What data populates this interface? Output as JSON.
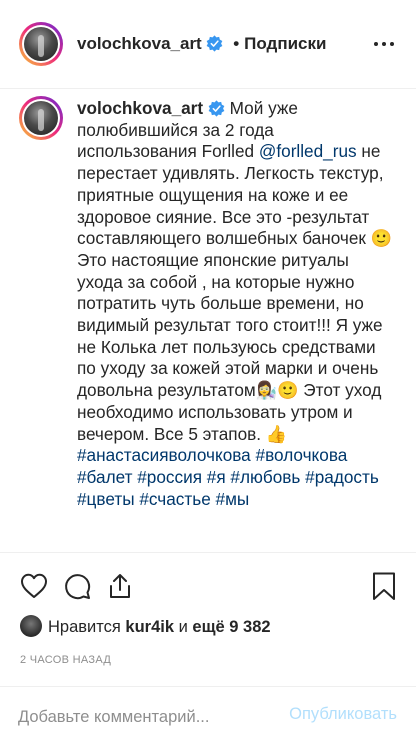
{
  "header": {
    "username": "volochkova_art",
    "separator": "•",
    "follow_status": "Подписки"
  },
  "caption": {
    "username": "volochkova_art",
    "text_part1": "Мой уже полюбившийся за 2 года использования Forlled ",
    "mention": "@forlled_rus",
    "text_part2": " не перестает удивлять. Легкость текстур, приятные ощущения на коже и ее здоровое сияние. Все это -результат составляющего волшебных баночек ",
    "emoji1": "🙂",
    "text_part3": " Это настоящие японские ритуалы ухода за собой , на которые нужно потратить чуть больше времени, но видимый результат того стоит!!! Я уже не Колька лет пользуюсь средствами по уходу за кожей этой марки и очень довольна результатом",
    "emoji2": "👩‍🔬🙂",
    "text_part4": " Этот уход необходимо использовать утром и вечером. Все 5 этапов. ",
    "emoji3": "👍",
    "hashtags": "#анастасияволочкова #волочкова #балет #россия #я #любовь #радость #цветы #счастье #мы"
  },
  "likes": {
    "prefix": "Нравится ",
    "user": "kur4ik",
    "conj": " и ",
    "others": "ещё 9 382"
  },
  "time_ago": "2 ЧАСОВ НАЗАД",
  "comment": {
    "placeholder": "Добавьте комментарий...",
    "publish_label": "Опубликовать"
  },
  "icons": {
    "like": "heart-icon",
    "comment": "comment-icon",
    "share": "share-icon",
    "save": "bookmark-icon",
    "verified": "verified-badge-icon",
    "more": "more-options-icon"
  },
  "colors": {
    "verified": "#3897f0",
    "link": "#00376b",
    "muted": "#8e8e8e",
    "publish_disabled": "#b2dffc"
  }
}
